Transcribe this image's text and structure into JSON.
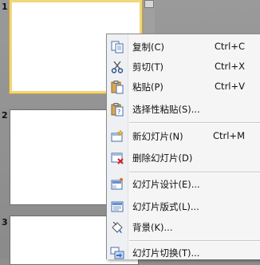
{
  "slides": [
    {
      "number": "1",
      "selected": true
    },
    {
      "number": "2",
      "selected": false
    },
    {
      "number": "3",
      "selected": false
    }
  ],
  "context_menu": {
    "items": [
      {
        "label": "复制(C)",
        "shortcut": "Ctrl+C",
        "icon": "copy-icon"
      },
      {
        "label": "剪切(T)",
        "shortcut": "Ctrl+X",
        "icon": "cut-icon"
      },
      {
        "label": "粘贴(P)",
        "shortcut": "Ctrl+V",
        "icon": "paste-icon"
      },
      {
        "label": "选择性粘贴(S)...",
        "shortcut": "",
        "icon": "paste-special-icon"
      },
      {
        "label": "新幻灯片(N)",
        "shortcut": "Ctrl+M",
        "icon": "new-slide-icon"
      },
      {
        "label": "删除幻灯片(D)",
        "shortcut": "",
        "icon": "delete-slide-icon"
      },
      {
        "label": "幻灯片设计(E)...",
        "shortcut": "",
        "icon": "slide-design-icon"
      },
      {
        "label": "幻灯片版式(L)...",
        "shortcut": "",
        "icon": "slide-layout-icon"
      },
      {
        "label": "背景(K)...",
        "shortcut": "",
        "icon": "background-icon"
      },
      {
        "label": "幻灯片切换(T)...",
        "shortcut": "",
        "icon": "slide-transition-icon"
      }
    ]
  },
  "colors": {
    "selection_border": "#f2d67a",
    "panel_background": "#8f8f8f",
    "menu_background": "#f5f5f5"
  }
}
